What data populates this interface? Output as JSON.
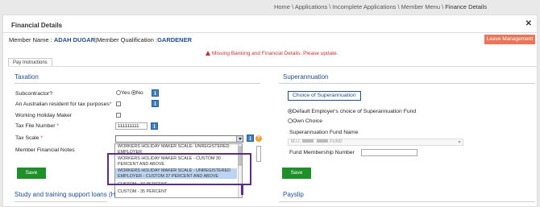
{
  "breadcrumb": {
    "items": [
      "Home",
      "Applications",
      "Incomplete Applications",
      "Member Menu"
    ],
    "current": "Finance Details",
    "separator": "\\"
  },
  "panel": {
    "title": "Financial Details",
    "close_glyph": "✕"
  },
  "member": {
    "name_label": "Member Name :",
    "name_value": "ADAH DUGAR",
    "divider": "|",
    "qual_label": "Member Qualification :",
    "qual_value": "GARDENER"
  },
  "leave_button": "Leave Management",
  "warning": "Missing Banking and Financial Details. Please update.",
  "tabs": [
    "Pay Instructions"
  ],
  "taxation": {
    "heading": "Taxation",
    "subcontractor_label": "Subcontractor?",
    "yes_label": "Yes",
    "no_label": "No",
    "resident_label": "An Australian resident for tax purposes",
    "holiday_label": "Working Holiday Maker",
    "tfn_label": "Tax File Number",
    "tfn_value": "111111111",
    "taxscale_label": "Tax Scale",
    "notes_label": "Member Financial Notes",
    "save_label": "Save",
    "required_mark": "*"
  },
  "tax_scale_options": [
    "WORKERS HOLIDAY MAKER SCALE- UNREGISTERED EMPLOYER",
    "WORKERS HOLIDAY MAKER SCALE - CUSTOM 30 PERCENT AND ABOVE",
    "WORKERS HOLIDAY MAKER SCALE - UNREGISTERED EMPLOYER - CUSTOM 37 PERCENT AND ABOVE",
    "CUSTOM - 37 PERCENT",
    "CUSTOM - 35 PERCENT"
  ],
  "superannuation": {
    "heading": "Superannuation",
    "choice_legend": "Choice of Superannuation",
    "default_option": "Default Employer's choice of Superannuation Fund",
    "own_option": "Own Choice",
    "fund_name_label": "Superannuation Fund Name",
    "fund_name_prefix": "M.I.I.",
    "fund_name_suffix": "FUND",
    "membership_label": "Fund Membership Number",
    "save_label": "Save"
  },
  "lower_sections": {
    "study_heading": "Study and training support loans (H",
    "payslip_heading": "Payslip"
  },
  "icons": {
    "info": "i",
    "help": "?"
  },
  "colors": {
    "accent_blue": "#1f4e8f",
    "save_green": "#1f8f2a",
    "warning_red": "#c9302c",
    "leave_orange": "#e9755a",
    "highlight_purple": "#5b2d86"
  }
}
